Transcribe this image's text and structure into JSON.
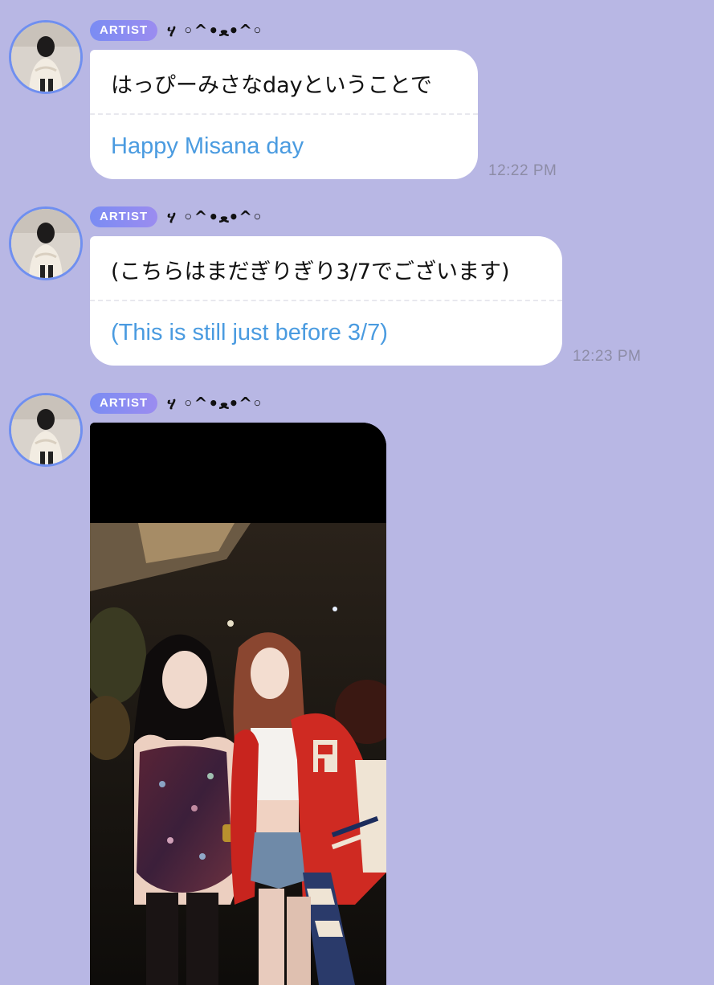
{
  "messages": [
    {
      "badge": "ARTIST",
      "sender": "ሃ ◦^•ﻌ•^◦",
      "original": "はっぴーみさなdayということで",
      "translation": "Happy Misana day",
      "time": "12:22 PM"
    },
    {
      "badge": "ARTIST",
      "sender": "ሃ ◦^•ﻌ•^◦",
      "original": "(こちらはまだぎりぎり3/7でございます)",
      "translation": "(This is still just before 3/7)",
      "time": "12:23 PM"
    },
    {
      "badge": "ARTIST",
      "sender": "ሃ ◦^•ﻌ•^◦",
      "attachment": "photo"
    }
  ],
  "colors": {
    "background": "#b8b7e4",
    "badge": "#7a8cf3",
    "translation_text": "#4a9be0",
    "avatar_ring": "#6f8ff0"
  }
}
